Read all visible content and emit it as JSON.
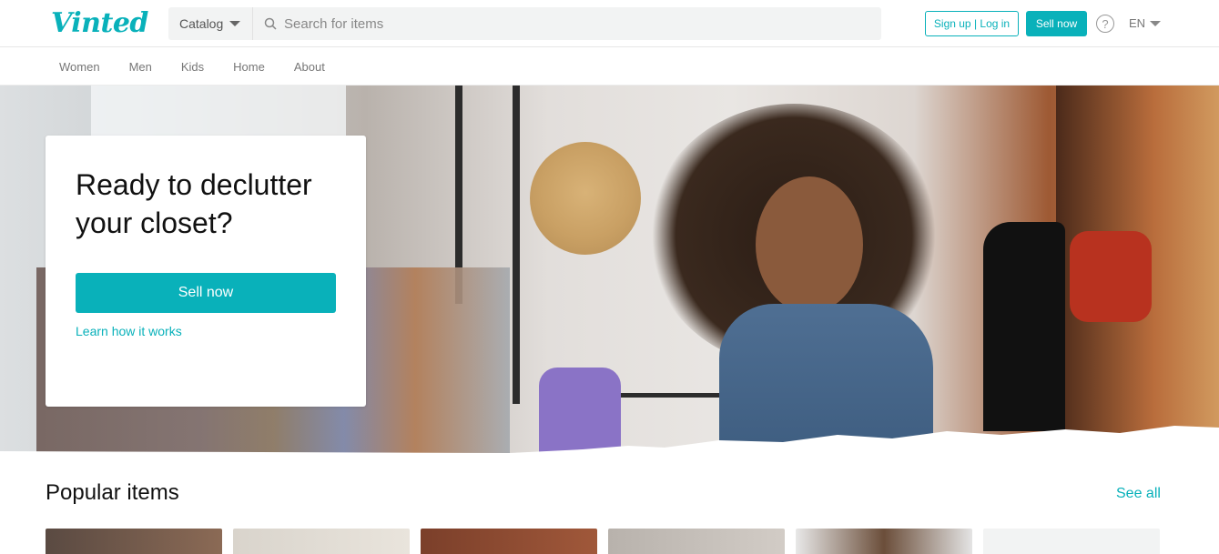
{
  "header": {
    "logo": "Vinted",
    "catalog_label": "Catalog",
    "search_placeholder": "Search for items",
    "signup_login": "Sign up | Log in",
    "sell_now": "Sell now",
    "help_icon": "question-circle-icon",
    "language": "EN"
  },
  "nav": {
    "items": [
      "Women",
      "Men",
      "Kids",
      "Home",
      "About"
    ]
  },
  "hero": {
    "title": "Ready to declutter your closet?",
    "sell_button": "Sell now",
    "learn_link": "Learn how it works"
  },
  "popular": {
    "title": "Popular items",
    "see_all": "See all"
  },
  "colors": {
    "brand": "#09b1ba"
  }
}
